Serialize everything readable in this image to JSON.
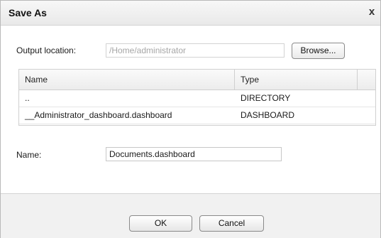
{
  "dialog": {
    "title": "Save As",
    "close_glyph": "x"
  },
  "output": {
    "label": "Output location:",
    "value": "/Home/administrator",
    "browse_label": "Browse..."
  },
  "file_table": {
    "headers": {
      "name": "Name",
      "type": "Type"
    },
    "rows": [
      {
        "name": "..",
        "type": "DIRECTORY"
      },
      {
        "name": "__Administrator_dashboard.dashboard",
        "type": "DASHBOARD"
      }
    ]
  },
  "name_field": {
    "label": "Name:",
    "value": "Documents.dashboard"
  },
  "buttons": {
    "ok": "OK",
    "cancel": "Cancel"
  }
}
